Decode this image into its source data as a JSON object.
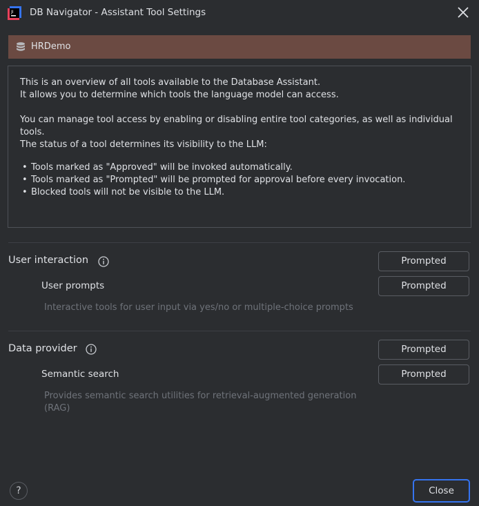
{
  "window": {
    "title": "DB Navigator - Assistant Tool Settings"
  },
  "connection": {
    "name": "HRDemo",
    "color": "#6b4a42"
  },
  "overview": {
    "line1": "This is an overview of all tools available to the Database Assistant.",
    "line2": "It allows you to determine which tools the language model can access.",
    "line3": "You can manage tool access by enabling or disabling entire tool categories, as well as individual",
    "line4": "tools.",
    "line5": "The status of a tool determines its visibility to the LLM:",
    "bullets": [
      "Tools marked as \"Approved\" will be invoked automatically.",
      "Tools marked as \"Prompted\" will be prompted for approval before every invocation.",
      "Blocked tools will not be visible to the LLM."
    ]
  },
  "categories": [
    {
      "label": "User interaction",
      "state": "Prompted",
      "tools": [
        {
          "label": "User prompts",
          "state": "Prompted",
          "description_lines": [
            "Interactive tools for user input via yes/no or multiple-choice prompts"
          ]
        }
      ]
    },
    {
      "label": "Data provider",
      "state": "Prompted",
      "tools": [
        {
          "label": "Semantic search",
          "state": "Prompted",
          "description_lines": [
            "Provides semantic search utilities for retrieval-augmented generation",
            "(RAG)"
          ]
        }
      ]
    }
  ],
  "footer": {
    "help_label": "?",
    "close_label": "Close"
  },
  "colors": {
    "background": "#2b2d30",
    "accent": "#3574f0",
    "muted_text": "#6f737a"
  }
}
